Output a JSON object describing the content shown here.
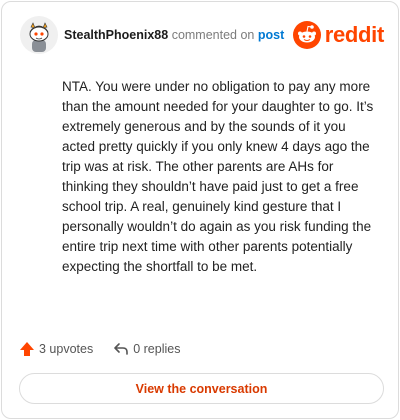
{
  "header": {
    "username": "StealthPhoenix88",
    "action_text": "commented on",
    "target_link": "post",
    "brand_name": "reddit",
    "avatar_icon": "snoo-avatar-icon",
    "logo_icon": "reddit-logo-icon"
  },
  "comment": {
    "text": "NTA. You were under no obligation to pay any more than the amount needed for your daughter to go. It’s extremely generous and by the sounds of it you acted pretty quickly if you only knew 4 days ago the trip was at risk. The other parents are AHs for thinking they shouldn’t have paid just to get a free school trip. A real, genuinely kind gesture that I personally wouldn’t do again as you risk funding the entire trip next time with other parents potentially expecting the shortfall to be met."
  },
  "meta": {
    "upvotes_label": "3 upvotes",
    "replies_label": "0 replies",
    "upvote_icon": "upvote-arrow-icon",
    "reply_icon": "reply-arrow-icon"
  },
  "cta": {
    "label": "View the conversation"
  },
  "colors": {
    "brand": "#ff4500",
    "link": "#0079d3",
    "cta_text": "#d93a00",
    "upvote": "#ff4500"
  }
}
